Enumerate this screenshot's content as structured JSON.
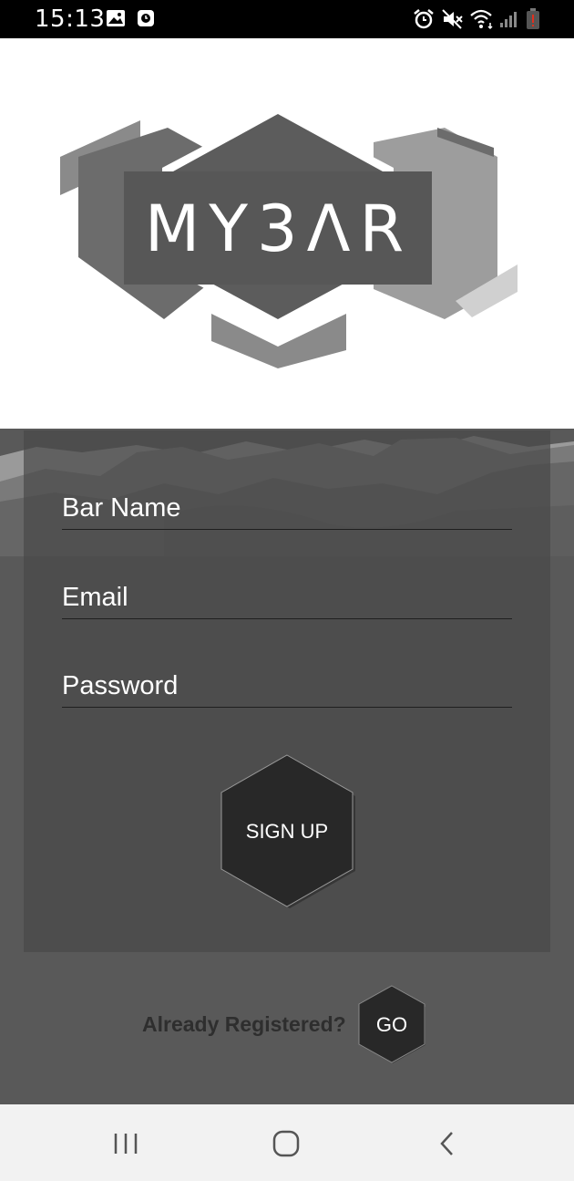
{
  "status_bar": {
    "time": "15:13"
  },
  "logo": {
    "text": "MY3ΛR"
  },
  "form": {
    "bar_name_placeholder": "Bar Name",
    "email_placeholder": "Email",
    "password_placeholder": "Password",
    "signup_label": "SIGN UP"
  },
  "footer": {
    "already_registered": "Already Registered?",
    "go_label": "GO"
  },
  "colors": {
    "status_bar": "#000000",
    "form_background": "#595959",
    "card_background": "#4b4b4b",
    "button_dark": "#282828",
    "nav_background": "#f2f2f2"
  }
}
